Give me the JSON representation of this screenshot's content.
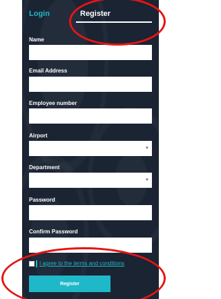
{
  "tabs": {
    "login_label": "Login",
    "register_label": "Register"
  },
  "form": {
    "name_label": "Name",
    "email_label": "Email Address",
    "employee_label": "Employee number",
    "airport_label": "Airport",
    "department_label": "Department",
    "password_label": "Password",
    "confirm_password_label": "Confirm Password",
    "terms_label": "I agree to the terms and conditions",
    "register_button_label": "Register"
  },
  "colors": {
    "panel": "#1a2433",
    "accent": "#1fb8c9",
    "annotation": "#e41515"
  },
  "icons": {
    "select_caret": "chevron-down-icon"
  }
}
